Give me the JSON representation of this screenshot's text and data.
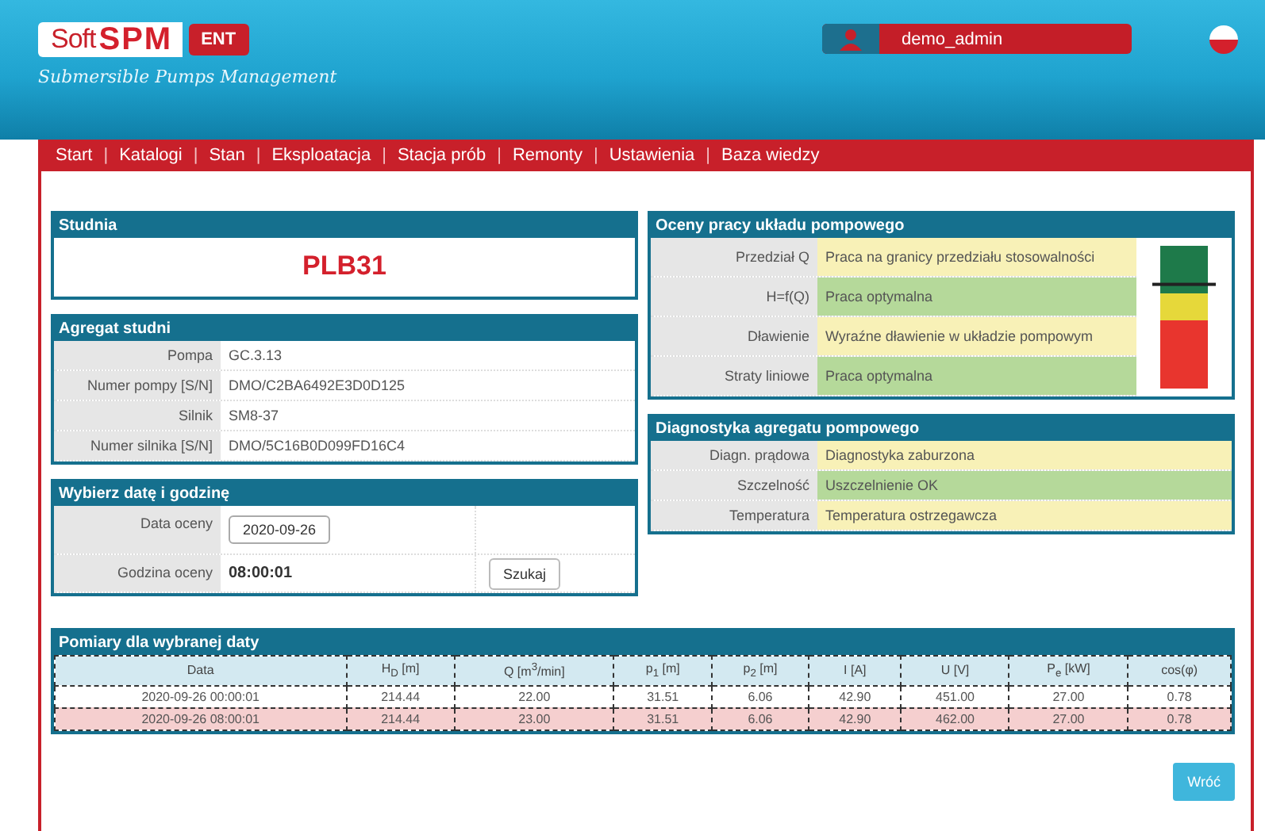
{
  "header": {
    "logo_soft": "Soft",
    "logo_spm": "SPM",
    "logo_badge": "ENT",
    "subtitle": "Submersible Pumps Management",
    "user": "demo_admin"
  },
  "nav": {
    "separator": "|",
    "items": [
      {
        "label": "Start"
      },
      {
        "label": "Katalogi"
      },
      {
        "label": "Stan"
      },
      {
        "label": "Eksploatacja"
      },
      {
        "label": "Stacja prób"
      },
      {
        "label": "Remonty"
      },
      {
        "label": "Ustawienia"
      },
      {
        "label": "Baza wiedzy"
      }
    ]
  },
  "well": {
    "title": "Studnia",
    "name": "PLB31"
  },
  "unit": {
    "title": "Agregat studni",
    "rows": [
      {
        "label": "Pompa",
        "value": "GC.3.13"
      },
      {
        "label": "Numer pompy [S/N]",
        "value": "DMO/C2BA6492E3D0D125"
      },
      {
        "label": "Silnik",
        "value": "SM8-37"
      },
      {
        "label": "Numer silnika [S/N]",
        "value": "DMO/5C16B0D099FD16C4"
      }
    ]
  },
  "pick": {
    "title": "Wybierz datę i godzinę",
    "date_label": "Data oceny",
    "date": "2020-09-26",
    "time_label": "Godzina oceny",
    "time": "08:00:01",
    "search_button": "Szukaj"
  },
  "ratings": {
    "title": "Oceny pracy układu pompowego",
    "gauge": {
      "level": 0.73
    },
    "rows": [
      {
        "label": "Przedział Q",
        "value": "Praca na granicy przedziału stosowalności",
        "color": "#f8f1b7"
      },
      {
        "label": "H=f(Q)",
        "value": "Praca optymalna",
        "color": "#b5d99a"
      },
      {
        "label": "Dławienie",
        "value": "Wyraźne dławienie w układzie pompowym",
        "color": "#f8f1b7"
      },
      {
        "label": "Straty liniowe",
        "value": "Praca optymalna",
        "color": "#b5d99a"
      }
    ]
  },
  "diagnostics": {
    "title": "Diagnostyka agregatu pompowego",
    "rows": [
      {
        "label": "Diagn. prądowa",
        "value": "Diagnostyka zaburzona",
        "color": "#f8f1b7"
      },
      {
        "label": "Szczelność",
        "value": "Uszczelnienie OK",
        "color": "#b5d99a"
      },
      {
        "label": "Temperatura",
        "value": "Temperatura ostrzegawcza",
        "color": "#f8f1b7"
      }
    ]
  },
  "measurements": {
    "title": "Pomiary dla wybranej daty",
    "columns": [
      "Data",
      "H$_{D}$ [m]",
      "Q [m$^{3}$/min]",
      "p$_{1}$ [m]",
      "p$_{2}$ [m]",
      "I [A]",
      "U [V]",
      "P$_{e}$ [kW]",
      "cos(φ)"
    ],
    "rows": [
      {
        "selected": false,
        "cells": [
          "2020-09-26 00:00:01",
          "214.44",
          "22.00",
          "31.51",
          "6.06",
          "42.90",
          "451.00",
          "27.00",
          "0.78"
        ]
      },
      {
        "selected": true,
        "cells": [
          "2020-09-26 08:00:01",
          "214.44",
          "23.00",
          "31.51",
          "6.06",
          "42.90",
          "462.00",
          "27.00",
          "0.78"
        ]
      }
    ]
  },
  "back_button": "Wróć"
}
